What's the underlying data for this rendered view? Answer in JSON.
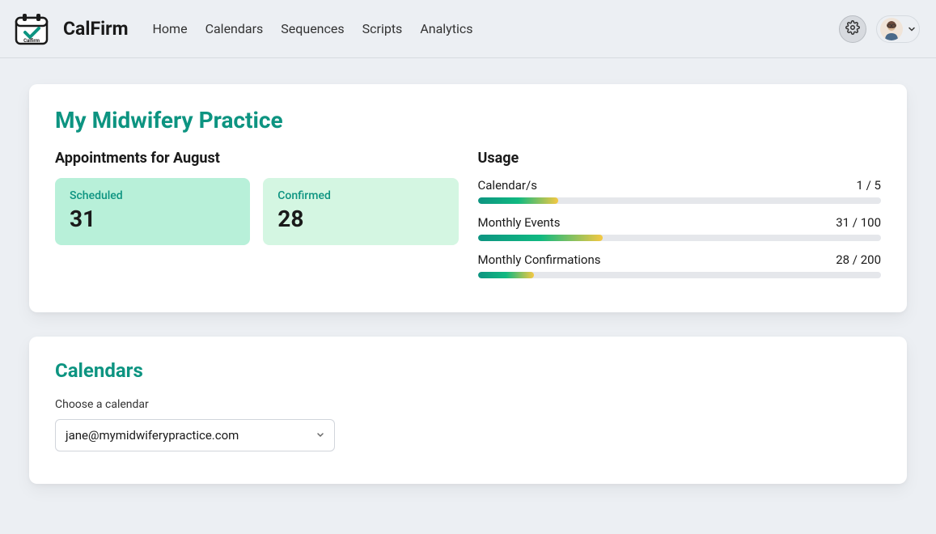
{
  "brand": "CalFirm",
  "nav": {
    "home": "Home",
    "calendars": "Calendars",
    "sequences": "Sequences",
    "scripts": "Scripts",
    "analytics": "Analytics"
  },
  "practice": {
    "title": "My Midwifery Practice",
    "appointments_heading": "Appointments for August",
    "stats": {
      "scheduled_label": "Scheduled",
      "scheduled_value": "31",
      "confirmed_label": "Confirmed",
      "confirmed_value": "28"
    },
    "usage_heading": "Usage",
    "usage": {
      "calendars": {
        "label": "Calendar/s",
        "value": "1 / 5",
        "percent": 20
      },
      "events": {
        "label": "Monthly Events",
        "value": "31 / 100",
        "percent": 31
      },
      "confirmations": {
        "label": "Monthly Confirmations",
        "value": "28 / 200",
        "percent": 14
      }
    }
  },
  "calendars_section": {
    "title": "Calendars",
    "choose_label": "Choose a calendar",
    "selected": "jane@mymidwiferypractice.com"
  }
}
